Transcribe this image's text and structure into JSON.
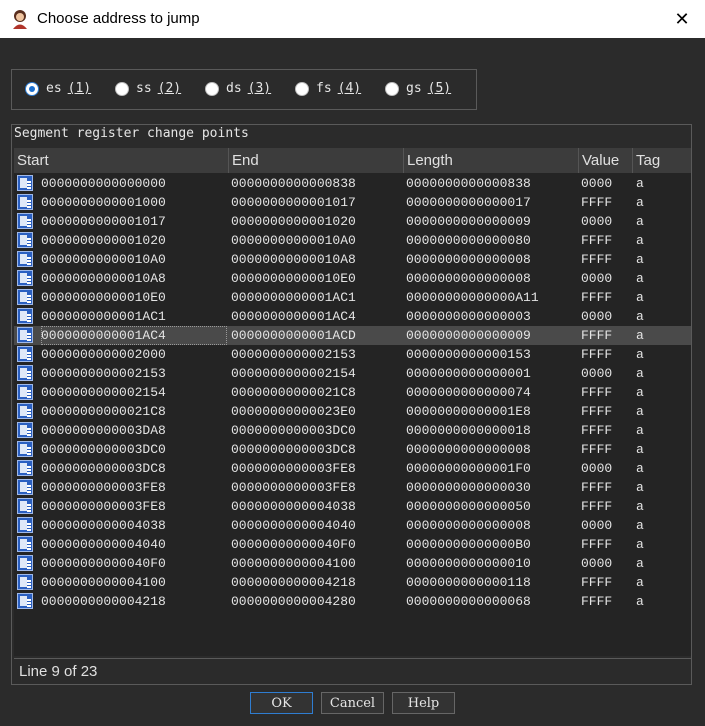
{
  "window": {
    "title": "Choose address to jump"
  },
  "segment_selector": {
    "selected": "es",
    "options": [
      {
        "name": "es",
        "key": "(1)"
      },
      {
        "name": "ss",
        "key": "(2)"
      },
      {
        "name": "ds",
        "key": "(3)"
      },
      {
        "name": "fs",
        "key": "(4)"
      },
      {
        "name": "gs",
        "key": "(5)"
      }
    ]
  },
  "table": {
    "caption": "Segment register change points",
    "columns": [
      "Start",
      "End",
      "Length",
      "Value",
      "Tag"
    ],
    "selected_index": 8,
    "rows": [
      [
        "0000000000000000",
        "0000000000000838",
        "0000000000000838",
        "0000",
        "a"
      ],
      [
        "0000000000001000",
        "0000000000001017",
        "0000000000000017",
        "FFFF",
        "a"
      ],
      [
        "0000000000001017",
        "0000000000001020",
        "0000000000000009",
        "0000",
        "a"
      ],
      [
        "0000000000001020",
        "00000000000010A0",
        "0000000000000080",
        "FFFF",
        "a"
      ],
      [
        "00000000000010A0",
        "00000000000010A8",
        "0000000000000008",
        "FFFF",
        "a"
      ],
      [
        "00000000000010A8",
        "00000000000010E0",
        "0000000000000008",
        "0000",
        "a"
      ],
      [
        "00000000000010E0",
        "0000000000001AC1",
        "00000000000000A11",
        "FFFF",
        "a"
      ],
      [
        "0000000000001AC1",
        "0000000000001AC4",
        "0000000000000003",
        "0000",
        "a"
      ],
      [
        "0000000000001AC4",
        "0000000000001ACD",
        "0000000000000009",
        "FFFF",
        "a"
      ],
      [
        "0000000000002000",
        "0000000000002153",
        "0000000000000153",
        "FFFF",
        "a"
      ],
      [
        "0000000000002153",
        "0000000000002154",
        "0000000000000001",
        "0000",
        "a"
      ],
      [
        "0000000000002154",
        "00000000000021C8",
        "0000000000000074",
        "FFFF",
        "a"
      ],
      [
        "00000000000021C8",
        "00000000000023E0",
        "00000000000001E8",
        "FFFF",
        "a"
      ],
      [
        "0000000000003DA8",
        "0000000000003DC0",
        "0000000000000018",
        "FFFF",
        "a"
      ],
      [
        "0000000000003DC0",
        "0000000000003DC8",
        "0000000000000008",
        "FFFF",
        "a"
      ],
      [
        "0000000000003DC8",
        "0000000000003FE8",
        "00000000000001F0",
        "0000",
        "a"
      ],
      [
        "0000000000003FE8",
        "0000000000003FE8",
        "0000000000000030",
        "FFFF",
        "a"
      ],
      [
        "0000000000003FE8",
        "0000000000004038",
        "0000000000000050",
        "FFFF",
        "a"
      ],
      [
        "0000000000004038",
        "0000000000004040",
        "0000000000000008",
        "0000",
        "a"
      ],
      [
        "0000000000004040",
        "00000000000040F0",
        "00000000000000B0",
        "FFFF",
        "a"
      ],
      [
        "00000000000040F0",
        "0000000000004100",
        "0000000000000010",
        "0000",
        "a"
      ],
      [
        "0000000000004100",
        "0000000000004218",
        "0000000000000118",
        "FFFF",
        "a"
      ],
      [
        "0000000000004218",
        "0000000000004280",
        "0000000000000068",
        "FFFF",
        "a"
      ]
    ]
  },
  "status": {
    "text": "Line 9 of 23"
  },
  "buttons": {
    "ok": {
      "label": "OK",
      "underline": "K"
    },
    "cancel": {
      "label": "Cancel"
    },
    "help": {
      "label": "Help"
    }
  },
  "icons": {
    "app": "ida-app-icon",
    "row": "segment-row-icon",
    "close": "close-icon"
  },
  "colors": {
    "accent": "#2f7dd1",
    "background": "#2b2b2b",
    "selected_row": "#4a4a4a"
  }
}
